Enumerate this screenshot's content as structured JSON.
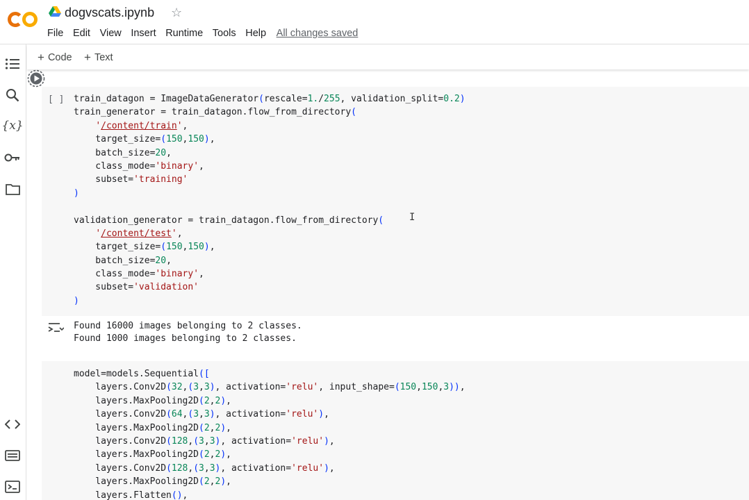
{
  "header": {
    "logo_text": "CO",
    "title": "dogvscats.ipynb",
    "menu": [
      "File",
      "Edit",
      "View",
      "Insert",
      "Runtime",
      "Tools",
      "Help"
    ],
    "save_status": "All changes saved"
  },
  "toolbar": {
    "add_code": "Code",
    "add_text": "Text"
  },
  "rail": {
    "icons": [
      "toc-icon",
      "search-icon",
      "variables-icon",
      "secrets-key-icon",
      "folder-icon",
      "code-snippets-icon",
      "command-palette-icon",
      "terminal-icon"
    ],
    "variables_glyph": "{x}"
  },
  "cell1": {
    "run_indicator": "[ ]",
    "code": [
      "train_datagon = ImageDataGenerator(rescale=1./255, validation_split=0.2)",
      "train_generator = train_datagon.flow_from_directory(",
      "    '/content/train',",
      "    target_size=(150,150),",
      "    batch_size=20,",
      "    class_mode='binary',",
      "    subset='training'",
      ")",
      "",
      "validation_generator = train_datagon.flow_from_directory(",
      "    '/content/test',",
      "    target_size=(150,150),",
      "    batch_size=20,",
      "    class_mode='binary',",
      "    subset='validation'",
      ")"
    ],
    "output": [
      "Found 16000 images belonging to 2 classes.",
      "Found 1000 images belonging to 2 classes."
    ]
  },
  "cell2": {
    "code": [
      "model=models.Sequential([",
      "    layers.Conv2D(32,(3,3), activation='relu', input_shape=(150,150,3)),",
      "    layers.MaxPooling2D(2,2),",
      "    layers.Conv2D(64,(3,3), activation='relu'),",
      "    layers.MaxPooling2D(2,2),",
      "    layers.Conv2D(128,(3,3), activation='relu'),",
      "    layers.MaxPooling2D(2,2),",
      "    layers.Conv2D(128,(3,3), activation='relu'),",
      "    layers.MaxPooling2D(2,2),",
      "    layers.Flatten(),"
    ]
  },
  "colors": {
    "logo_orange": "#f9ab00",
    "logo_deep_orange": "#e8710a",
    "string": "#a31515",
    "number": "#098658",
    "bracket": "#0431fa",
    "cell_bg": "#f7f7f7"
  }
}
